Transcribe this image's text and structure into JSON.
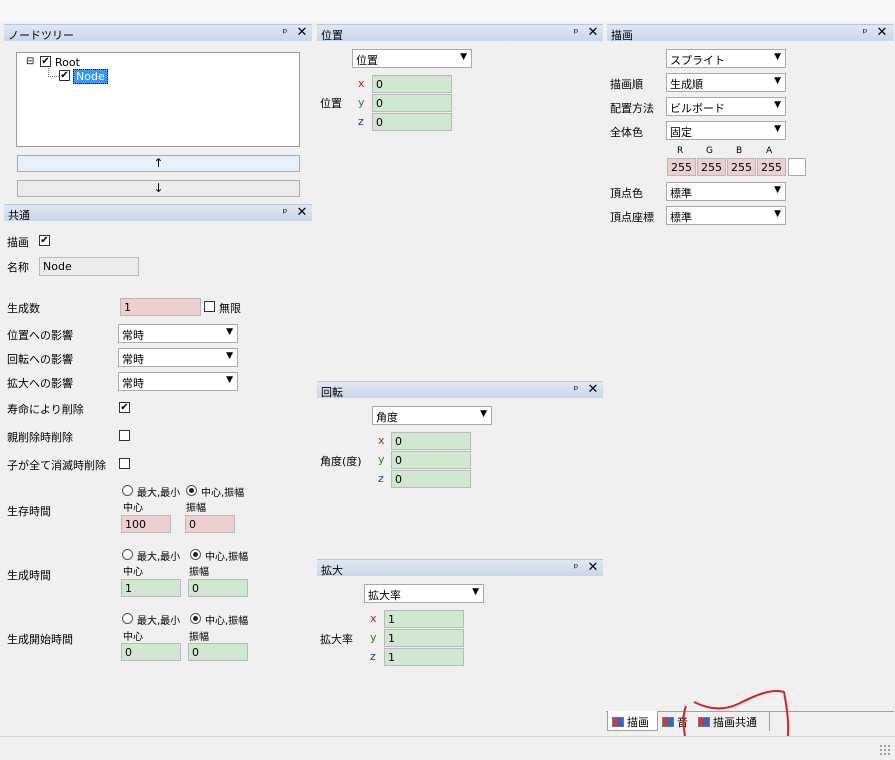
{
  "node_tree": {
    "title": "ノードツリー",
    "root_label": "Root",
    "child_label": "Node",
    "expand_glyph": "⊟",
    "up_glyph": "↑",
    "down_glyph": "↓"
  },
  "panel_icons": {
    "pin": "ᵖ",
    "close": "✕"
  },
  "common": {
    "title": "共通",
    "draw_label": "描画",
    "name_label": "名称",
    "name_value": "Node",
    "gen_count_label": "生成数",
    "gen_count_value": "1",
    "infinite_label": "無限",
    "pos_influence_label": "位置への影響",
    "pos_influence_value": "常時",
    "rot_influence_label": "回転への影響",
    "rot_influence_value": "常時",
    "scale_influence_label": "拡大への影響",
    "scale_influence_value": "常時",
    "life_delete_label": "寿命により削除",
    "parent_delete_label": "親削除時削除",
    "children_delete_label": "子が全て消滅時削除",
    "radio_minmax": "最大,最小",
    "radio_center": "中心,振幅",
    "center_label": "中心",
    "amp_label": "振幅",
    "lifetime_label": "生存時間",
    "lifetime_center": "100",
    "lifetime_amp": "0",
    "gen_time_label": "生成時間",
    "gen_time_center": "1",
    "gen_time_amp": "0",
    "gen_start_label": "生成開始時間",
    "gen_start_center": "0",
    "gen_start_amp": "0"
  },
  "position": {
    "title": "位置",
    "mode": "位置",
    "label": "位置",
    "x": "0",
    "y": "0",
    "z": "0"
  },
  "rotation": {
    "title": "回転",
    "mode": "角度",
    "label": "角度(度)",
    "x": "0",
    "y": "0",
    "z": "0"
  },
  "scale": {
    "title": "拡大",
    "mode": "拡大率",
    "label": "拡大率",
    "x": "1",
    "y": "1",
    "z": "1"
  },
  "axes": {
    "x": "x",
    "y": "y",
    "z": "z"
  },
  "drawing": {
    "title": "描画",
    "type": "スプライト",
    "order_label": "描画順",
    "order_value": "生成順",
    "placement_label": "配置方法",
    "placement_value": "ビルボード",
    "all_color_label": "全体色",
    "all_color_value": "固定",
    "r_label": "R",
    "g_label": "G",
    "b_label": "B",
    "a_label": "A",
    "r": "255",
    "g": "255",
    "b": "255",
    "a": "255",
    "vertex_color_label": "頂点色",
    "vertex_color_value": "標準",
    "vertex_coord_label": "頂点座標",
    "vertex_coord_value": "標準"
  },
  "tabs": [
    {
      "label": "描画"
    },
    {
      "label": "音"
    },
    {
      "label": "描画共通"
    }
  ],
  "colors": {
    "annotation": "#e02020",
    "field_green": "#cfe8cf",
    "field_pink": "#ecd0d0"
  }
}
